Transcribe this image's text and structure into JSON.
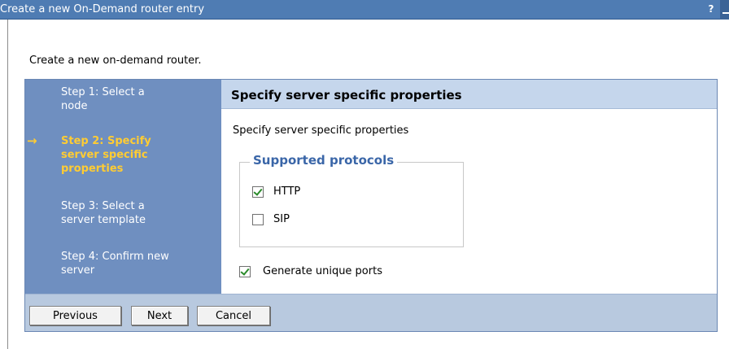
{
  "window": {
    "title": "Create a new On-Demand router entry",
    "help_label": "?"
  },
  "intro_text": "Create a new on-demand router.",
  "steps": [
    {
      "label_line1": "Step 1: Select a",
      "label_line2": "node",
      "current": false
    },
    {
      "label_line1": "Step 2: Specify",
      "label_line2": "server specific",
      "label_line3": "properties",
      "current": true
    },
    {
      "label_line1": "Step 3: Select a",
      "label_line2": "server template",
      "current": false
    },
    {
      "label_line1": "Step 4: Confirm new",
      "label_line2": "server",
      "current": false
    }
  ],
  "current_step_arrow": "→",
  "content": {
    "header": "Specify server specific properties",
    "description": "Specify server specific properties",
    "protocols_legend": "Supported protocols",
    "protocols": [
      {
        "label": "HTTP",
        "checked": true
      },
      {
        "label": "SIP",
        "checked": false
      }
    ],
    "generate_ports": {
      "label": "Generate unique ports",
      "checked": true
    }
  },
  "buttons": {
    "previous": "Previous",
    "next": "Next",
    "cancel": "Cancel"
  },
  "colors": {
    "title_bar": "#4f7cb3",
    "step_panel": "#6f8fc0",
    "current_step": "#ffcc33",
    "header_band": "#c5d6ec",
    "legend_text": "#3a66a8",
    "button_bar": "#b8c9df"
  }
}
